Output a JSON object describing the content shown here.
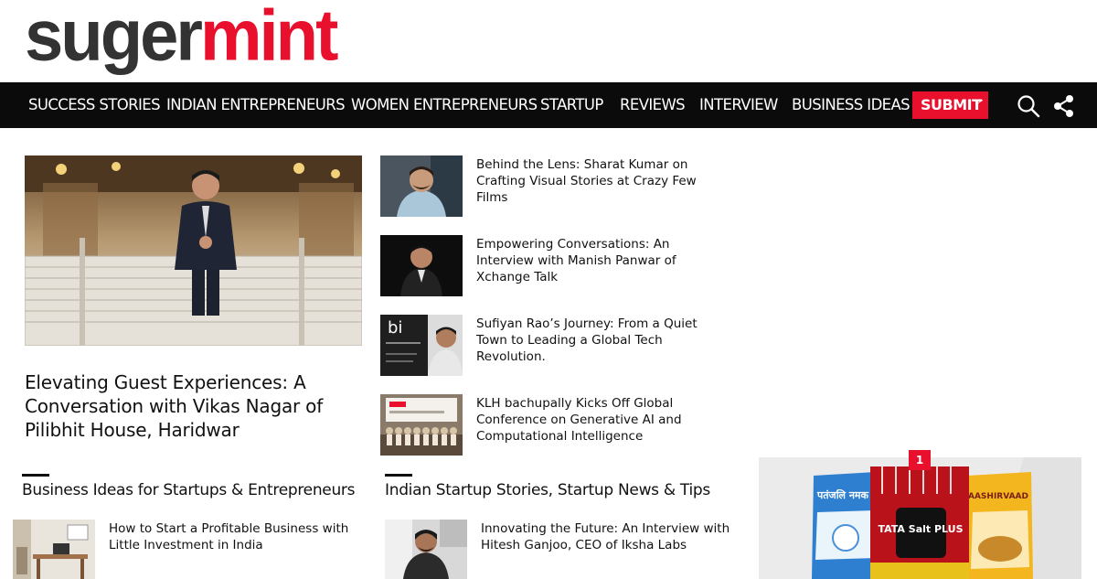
{
  "logo": {
    "part1": "suger",
    "part2": "mint"
  },
  "nav": {
    "items": [
      {
        "label": "SUCCESS STORIES"
      },
      {
        "label": "INDIAN ENTREPRENEURS"
      },
      {
        "label": "WOMEN ENTREPRENEURS"
      },
      {
        "label": "STARTUP"
      },
      {
        "label": "REVIEWS"
      },
      {
        "label": "INTERVIEW"
      },
      {
        "label": "BUSINESS IDEAS"
      }
    ],
    "submit_label": "SUBMIT",
    "submit_chevron": "﹀"
  },
  "featured": {
    "title": "Elevating Guest Experiences: A Conversation with Vikas Nagar of Pilibhit House, Haridwar"
  },
  "side_articles": [
    {
      "title": "Behind the Lens: Sharat Kumar on Crafting Visual Stories at Crazy Few Films"
    },
    {
      "title": "Empowering Conversations: An Interview with Manish Panwar of Xchange Talk"
    },
    {
      "title": "Sufiyan Rao’s Journey: From a Quiet Town to Leading a Global Tech Revolution."
    },
    {
      "title": "KLH bachupally Kicks Off Global Conference on Generative AI and Computational Intelligence"
    }
  ],
  "sections": [
    {
      "title": "Business Ideas for Startups & Entrepreneurs",
      "first_article": "How to Start a Profitable Business with Little Investment in India"
    },
    {
      "title": "Indian Startup Stories, Startup News & Tips",
      "first_article": "Innovating the Future: An Interview with Hitesh Ganjoo, CEO of Iksha Labs"
    }
  ],
  "ad": {
    "badge": "1",
    "products": [
      "पतंजलि नमक",
      "TATA Salt PLUS",
      "AASHIRVAAD"
    ]
  },
  "colors": {
    "brand_red": "#e8102c",
    "logo_grey": "#333333",
    "nav_bg": "#0b0b0b"
  },
  "icons": {
    "search": "search-icon",
    "share": "share-icon"
  }
}
